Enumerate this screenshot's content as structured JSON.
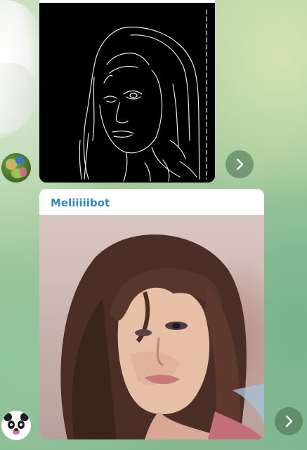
{
  "messages": [
    {
      "type": "photo",
      "image": "edge-detected-portrait",
      "avatar": "green-avatar",
      "forward_icon": "chevron-right-icon"
    },
    {
      "type": "photo",
      "sender": "Meliiiiibot",
      "image": "generated-portrait",
      "avatar": "panda-avatar",
      "forward_icon": "chevron-right-icon"
    }
  ],
  "colors": {
    "sender_name": "#2f8bc3",
    "bubble": "#ffffff",
    "forward_button": "#466e50"
  }
}
